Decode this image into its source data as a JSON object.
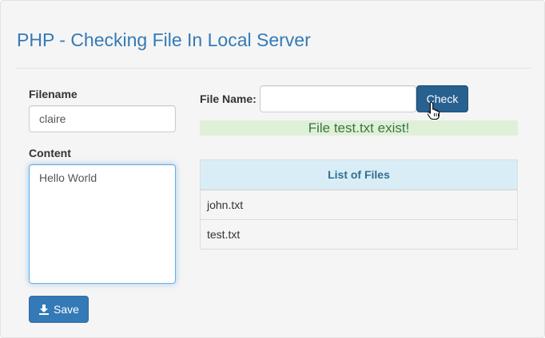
{
  "header": {
    "title": "PHP - Checking File In Local Server"
  },
  "form": {
    "filename_label": "Filename",
    "filename_value": "claire",
    "content_label": "Content",
    "content_value": "Hello World",
    "save_label": "Save",
    "save_icon": "download-icon"
  },
  "check": {
    "label": "File Name:",
    "input_value": "",
    "button_label": "Check",
    "result_message": "File test.txt exist!"
  },
  "files_table": {
    "header": "List of Files",
    "rows": [
      "john.txt",
      "test.txt"
    ]
  },
  "colors": {
    "primary": "#337ab7",
    "success_bg": "#dff0d8",
    "success_text": "#3c763d",
    "table_header_bg": "#d9edf7",
    "table_header_text": "#31708f"
  }
}
